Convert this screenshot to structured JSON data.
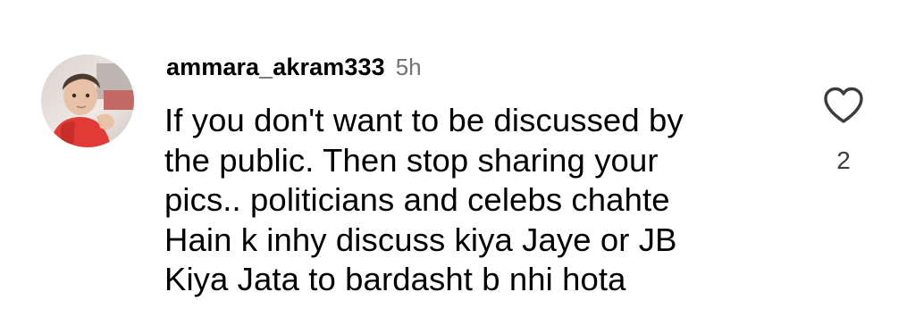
{
  "comment": {
    "username": "ammara_akram333",
    "timestamp": "5h",
    "text": "If you don't want to be discussed by\nthe public. Then stop sharing your\npics.. politicians and celebs chahte\nHain k inhy discuss kiya Jaye or JB\nKiya Jata to bardasht b nhi hota",
    "like_count": "2",
    "avatar_icon": "profile-photo",
    "like_icon": "heart-outline-icon"
  },
  "colors": {
    "background": "#ffffff",
    "text": "#000000",
    "timestamp": "#737373",
    "like_count": "#3c3c3c"
  }
}
